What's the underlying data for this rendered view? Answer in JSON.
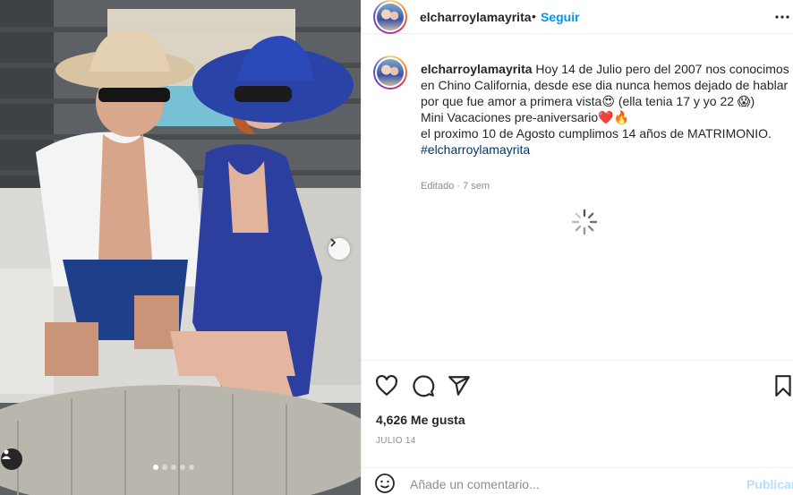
{
  "post": {
    "username": "elcharroylamayrita",
    "separator": "•",
    "follow_label": "Seguir",
    "caption": {
      "line1": "Hoy 14 de Julio pero del 2007 nos conocimos en Chino California, desde ese dia nunca hemos dejado de hablar por que fue amor a primera vista",
      "emoji1": "😍",
      "line1b": " (ella tenia 17 y yo 22 ",
      "emoji2": "😱",
      "line1c": ")",
      "line2": "Mini Vacaciones pre-aniversario",
      "emoji3": "❤️",
      "emoji4": "🔥",
      "line3": "el proximo 10 de Agosto cumplimos 14 años de MATRIMONIO.",
      "hashtag": "#elcharroylamayrita"
    },
    "edited": "Editado",
    "dot": "·",
    "age": "7 sem",
    "likes": "4,626 Me gusta",
    "date": "JULIO 14"
  },
  "comment": {
    "placeholder": "Añade un comentario...",
    "publish_label": "Publicar"
  },
  "carousel": {
    "slides": 5,
    "active": 1
  },
  "icons": [
    "more-options-icon",
    "heart-icon",
    "comment-icon",
    "share-icon",
    "bookmark-icon",
    "emoji-icon",
    "chevron-right-icon",
    "user-tag-icon",
    "loading-spinner-icon"
  ],
  "colors": {
    "accent": "#0095f6",
    "text": "#262626",
    "muted": "#8e8e8e",
    "hashtag": "#00376b",
    "publish_disabled": "#b2dffc"
  }
}
